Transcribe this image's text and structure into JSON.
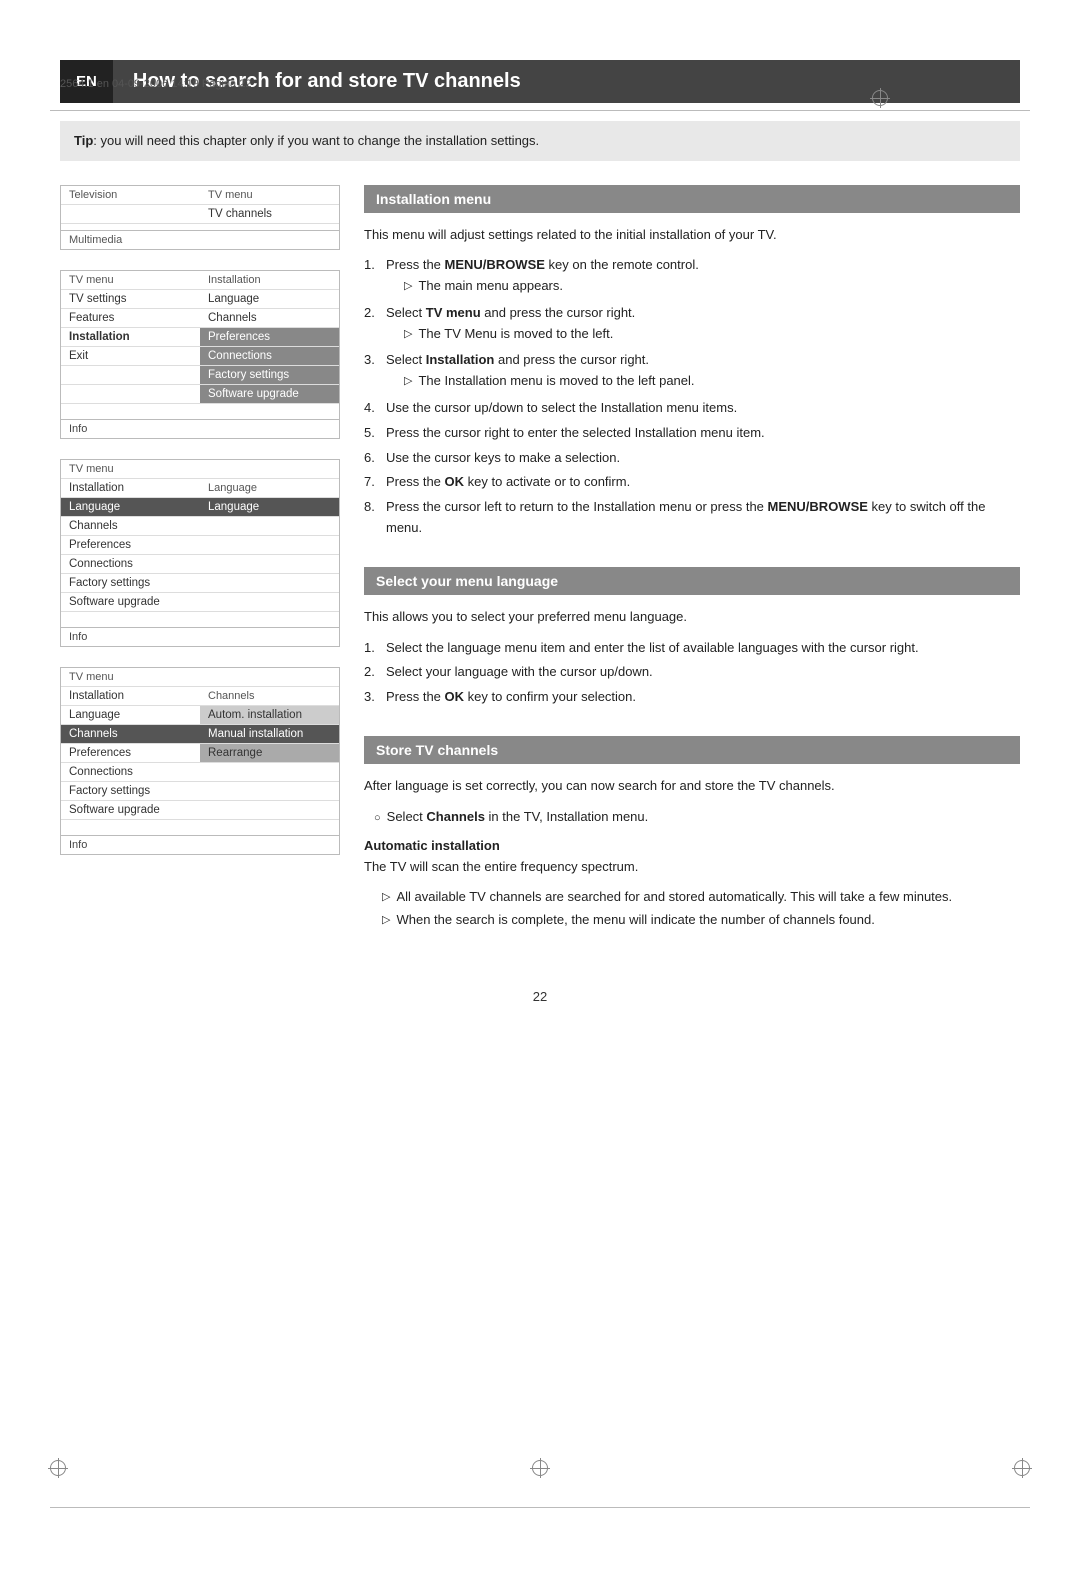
{
  "page_meta": {
    "text": "2564.1 en  04-09-2006  14:19  Pagina 22"
  },
  "header": {
    "badge": "EN",
    "title": "How to search for and store TV channels"
  },
  "tip": {
    "label": "Tip",
    "text": ": you will need this chapter only if you want to change the installation settings."
  },
  "diagram1": {
    "rows": [
      {
        "left": "Television",
        "right": "TV menu",
        "left_style": "header",
        "right_style": "header"
      },
      {
        "left": "",
        "right": "TV channels",
        "right_style": "normal"
      },
      {
        "left": "",
        "right": "",
        "right_style": "normal"
      },
      {
        "left": "Multimedia",
        "right": "",
        "left_style": "header",
        "right_style": "normal"
      }
    ]
  },
  "diagram2": {
    "rows": [
      {
        "left": "TV menu",
        "right": "Installation",
        "left_style": "header",
        "right_style": "header"
      },
      {
        "left": "TV settings",
        "right": "Language",
        "left_style": "normal",
        "right_style": "normal"
      },
      {
        "left": "Features",
        "right": "Channels",
        "left_style": "normal",
        "right_style": "normal"
      },
      {
        "left": "Installation",
        "right": "Preferences",
        "left_style": "bold",
        "right_style": "highlighted"
      },
      {
        "left": "Exit",
        "right": "Connections",
        "left_style": "normal",
        "right_style": "highlighted"
      },
      {
        "left": "",
        "right": "Factory settings",
        "left_style": "normal",
        "right_style": "highlighted"
      },
      {
        "left": "",
        "right": "Software upgrade",
        "left_style": "normal",
        "right_style": "highlighted"
      },
      {
        "left": "",
        "right": "",
        "left_style": "normal",
        "right_style": "normal"
      },
      {
        "left": "Info",
        "right": "",
        "left_style": "info",
        "right_style": "normal"
      }
    ]
  },
  "diagram3": {
    "rows": [
      {
        "left": "TV menu",
        "right": "",
        "left_style": "header",
        "right_style": "header"
      },
      {
        "left": "Installation",
        "right": "Language",
        "left_style": "normal",
        "right_style": "header"
      },
      {
        "left": "Language",
        "right": "Language",
        "left_style": "dark-highlighted",
        "right_style": "dark-highlighted"
      },
      {
        "left": "Channels",
        "right": "",
        "left_style": "normal",
        "right_style": "normal"
      },
      {
        "left": "Preferences",
        "right": "",
        "left_style": "normal",
        "right_style": "normal"
      },
      {
        "left": "Connections",
        "right": "",
        "left_style": "normal",
        "right_style": "normal"
      },
      {
        "left": "Factory settings",
        "right": "",
        "left_style": "normal",
        "right_style": "normal"
      },
      {
        "left": "Software upgrade",
        "right": "",
        "left_style": "normal",
        "right_style": "normal"
      },
      {
        "left": "",
        "right": "",
        "left_style": "normal",
        "right_style": "normal"
      },
      {
        "left": "Info",
        "right": "",
        "left_style": "info",
        "right_style": "normal"
      }
    ]
  },
  "diagram4": {
    "rows": [
      {
        "left": "TV menu",
        "right": "",
        "left_style": "header",
        "right_style": "header"
      },
      {
        "left": "Installation",
        "right": "Channels",
        "left_style": "normal",
        "right_style": "header"
      },
      {
        "left": "Language",
        "right": "Autom. installation",
        "left_style": "normal",
        "right_style": "light-highlighted"
      },
      {
        "left": "Channels",
        "right": "Manual installation",
        "left_style": "dark-highlighted",
        "right_style": "dark-highlighted"
      },
      {
        "left": "Preferences",
        "right": "Rearrange",
        "left_style": "normal",
        "right_style": "medium-highlighted"
      },
      {
        "left": "Connections",
        "right": "",
        "left_style": "normal",
        "right_style": "normal"
      },
      {
        "left": "Factory settings",
        "right": "",
        "left_style": "normal",
        "right_style": "normal"
      },
      {
        "left": "Software upgrade",
        "right": "",
        "left_style": "normal",
        "right_style": "normal"
      },
      {
        "left": "",
        "right": "",
        "left_style": "normal",
        "right_style": "normal"
      },
      {
        "left": "Info",
        "right": "",
        "left_style": "info",
        "right_style": "normal"
      }
    ]
  },
  "installation_menu": {
    "header": "Installation menu",
    "intro": "This menu will adjust settings related to the initial installation of your TV.",
    "steps": [
      {
        "num": "1.",
        "text": "Press the MENU/BROWSE key on the remote control.",
        "bold_parts": [
          "MENU/BROWSE"
        ],
        "sub": "The main menu appears."
      },
      {
        "num": "2.",
        "text": "Select TV menu and press the cursor right.",
        "bold_parts": [
          "TV menu"
        ],
        "sub": "The TV Menu is moved to the left."
      },
      {
        "num": "3.",
        "text": "Select Installation and press the cursor right.",
        "bold_parts": [
          "Installation"
        ],
        "sub": "The Installation menu is moved to the left panel."
      },
      {
        "num": "4.",
        "text": "Use the cursor up/down to select the Installation menu items.",
        "bold_parts": []
      },
      {
        "num": "5.",
        "text": "Press the cursor right to enter the selected Installation menu item.",
        "bold_parts": []
      },
      {
        "num": "6.",
        "text": "Use the cursor keys to make a selection.",
        "bold_parts": []
      },
      {
        "num": "7.",
        "text": "Press the OK key to activate or to confirm.",
        "bold_parts": [
          "OK"
        ]
      },
      {
        "num": "8.",
        "text": "Press the cursor left to return to the Installation menu or press the MENU/BROWSE key to switch off the menu.",
        "bold_parts": [
          "MENU/BROWSE"
        ]
      }
    ]
  },
  "select_language": {
    "header": "Select your menu language",
    "intro": "This allows you to select your preferred menu language.",
    "steps": [
      {
        "num": "1.",
        "text": "Select the language menu item and enter the list of available languages with the cursor right.",
        "bold_parts": []
      },
      {
        "num": "2.",
        "text": "Select your language with the cursor up/down.",
        "bold_parts": []
      },
      {
        "num": "3.",
        "text": "Press the OK key to confirm your selection.",
        "bold_parts": [
          "OK"
        ]
      }
    ]
  },
  "store_channels": {
    "header": "Store TV channels",
    "intro": "After language is set correctly, you can now search for and store the TV channels.",
    "bullet": "Select Channels in the TV, Installation menu.",
    "bullet_bold": "Channels",
    "auto_header": "Automatic installation",
    "auto_intro": "The TV will scan the entire frequency spectrum.",
    "auto_subs": [
      "All available TV channels are searched for and stored automatically. This will take a few minutes.",
      "When the search is complete, the menu will indicate the number of channels found."
    ]
  },
  "page_number": "22"
}
